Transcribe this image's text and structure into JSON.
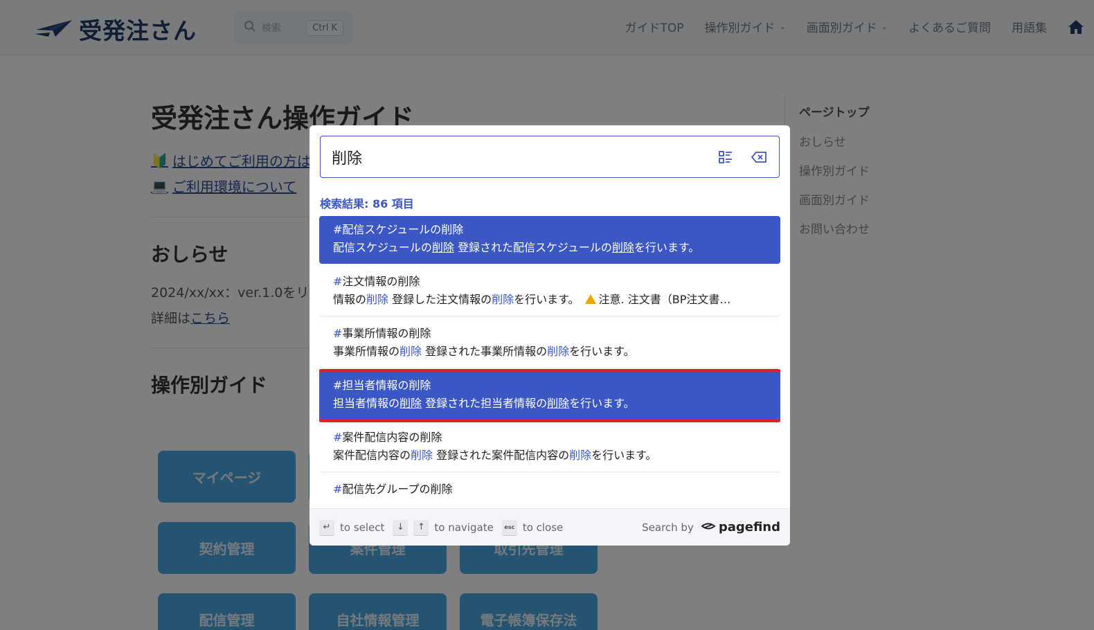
{
  "header": {
    "logo_text": "受発注さん",
    "search_placeholder": "検索",
    "search_shortcut": "Ctrl K",
    "nav": [
      {
        "label": "ガイドTOP"
      },
      {
        "label": "操作別ガイド"
      },
      {
        "label": "画面別ガイド"
      },
      {
        "label": "よくあるご質問"
      },
      {
        "label": "用語集"
      }
    ]
  },
  "main": {
    "title": "受発注さん操作ガイド",
    "links": [
      "はじめてご利用の方は",
      "ご利用環境について"
    ],
    "news_title": "おしらせ",
    "news_line": "2024/xx/xx：ver.1.0をリリ",
    "news_detail_prefix": "詳細は",
    "news_detail_link": "こちら",
    "guide_title": "操作別ガイド",
    "tiles": [
      "マイページ",
      "",
      "",
      "契約管理",
      "案件管理",
      "取引先管理",
      "配信管理",
      "自社情報管理",
      "電子帳簿保存法"
    ]
  },
  "toc": {
    "title": "ページトップ",
    "items": [
      "おしらせ",
      "操作別ガイド",
      "画面別ガイド",
      "お問い合わせ"
    ]
  },
  "modal": {
    "query": "削除",
    "count_label": "検索結果: 86 項目",
    "results": [
      {
        "hash": "#",
        "title": "配信スケジュールの削除",
        "d1": "配信スケジュールの",
        "h1": "削除",
        "d2": " 登録された配信スケジュールの",
        "h2": "削除",
        "d3": "を行います。",
        "extra": ""
      },
      {
        "hash": "#",
        "title": "注文情報の削除",
        "d1": "情報の",
        "h1": "削除",
        "d2": " 登録した注文情報の",
        "h2": "削除",
        "d3": "を行います。",
        "extra": "注意. 注文書（BP注文書…"
      },
      {
        "hash": "#",
        "title": "事業所情報の削除",
        "d1": "事業所情報の",
        "h1": "削除",
        "d2": " 登録された事業所情報の",
        "h2": "削除",
        "d3": "を行います。",
        "extra": ""
      },
      {
        "hash": "#",
        "title": "担当者情報の削除",
        "d1": "担当者情報の",
        "h1": "削除",
        "d2": " 登録された担当者情報の",
        "h2": "削除",
        "d3": "を行います。",
        "extra": ""
      },
      {
        "hash": "#",
        "title": "案件配信内容の削除",
        "d1": "案件配信内容の",
        "h1": "削除",
        "d2": " 登録された案件配信内容の",
        "h2": "削除",
        "d3": "を行います。",
        "extra": ""
      },
      {
        "hash": "#",
        "title": "配信先グループの削除",
        "d1": "",
        "h1": "",
        "d2": "",
        "h2": "",
        "d3": "",
        "extra": ""
      }
    ],
    "footer": {
      "select_key": "↵",
      "select_label": "to select",
      "down_key": "↓",
      "up_key": "↑",
      "navigate_label": "to navigate",
      "esc_key": "esc",
      "close_label": "to close",
      "search_by": "Search by",
      "brand": "pagefind"
    }
  },
  "colors": {
    "accent": "#3a57c4",
    "marker": "#e11d2a",
    "tile": "#49a8e3"
  }
}
